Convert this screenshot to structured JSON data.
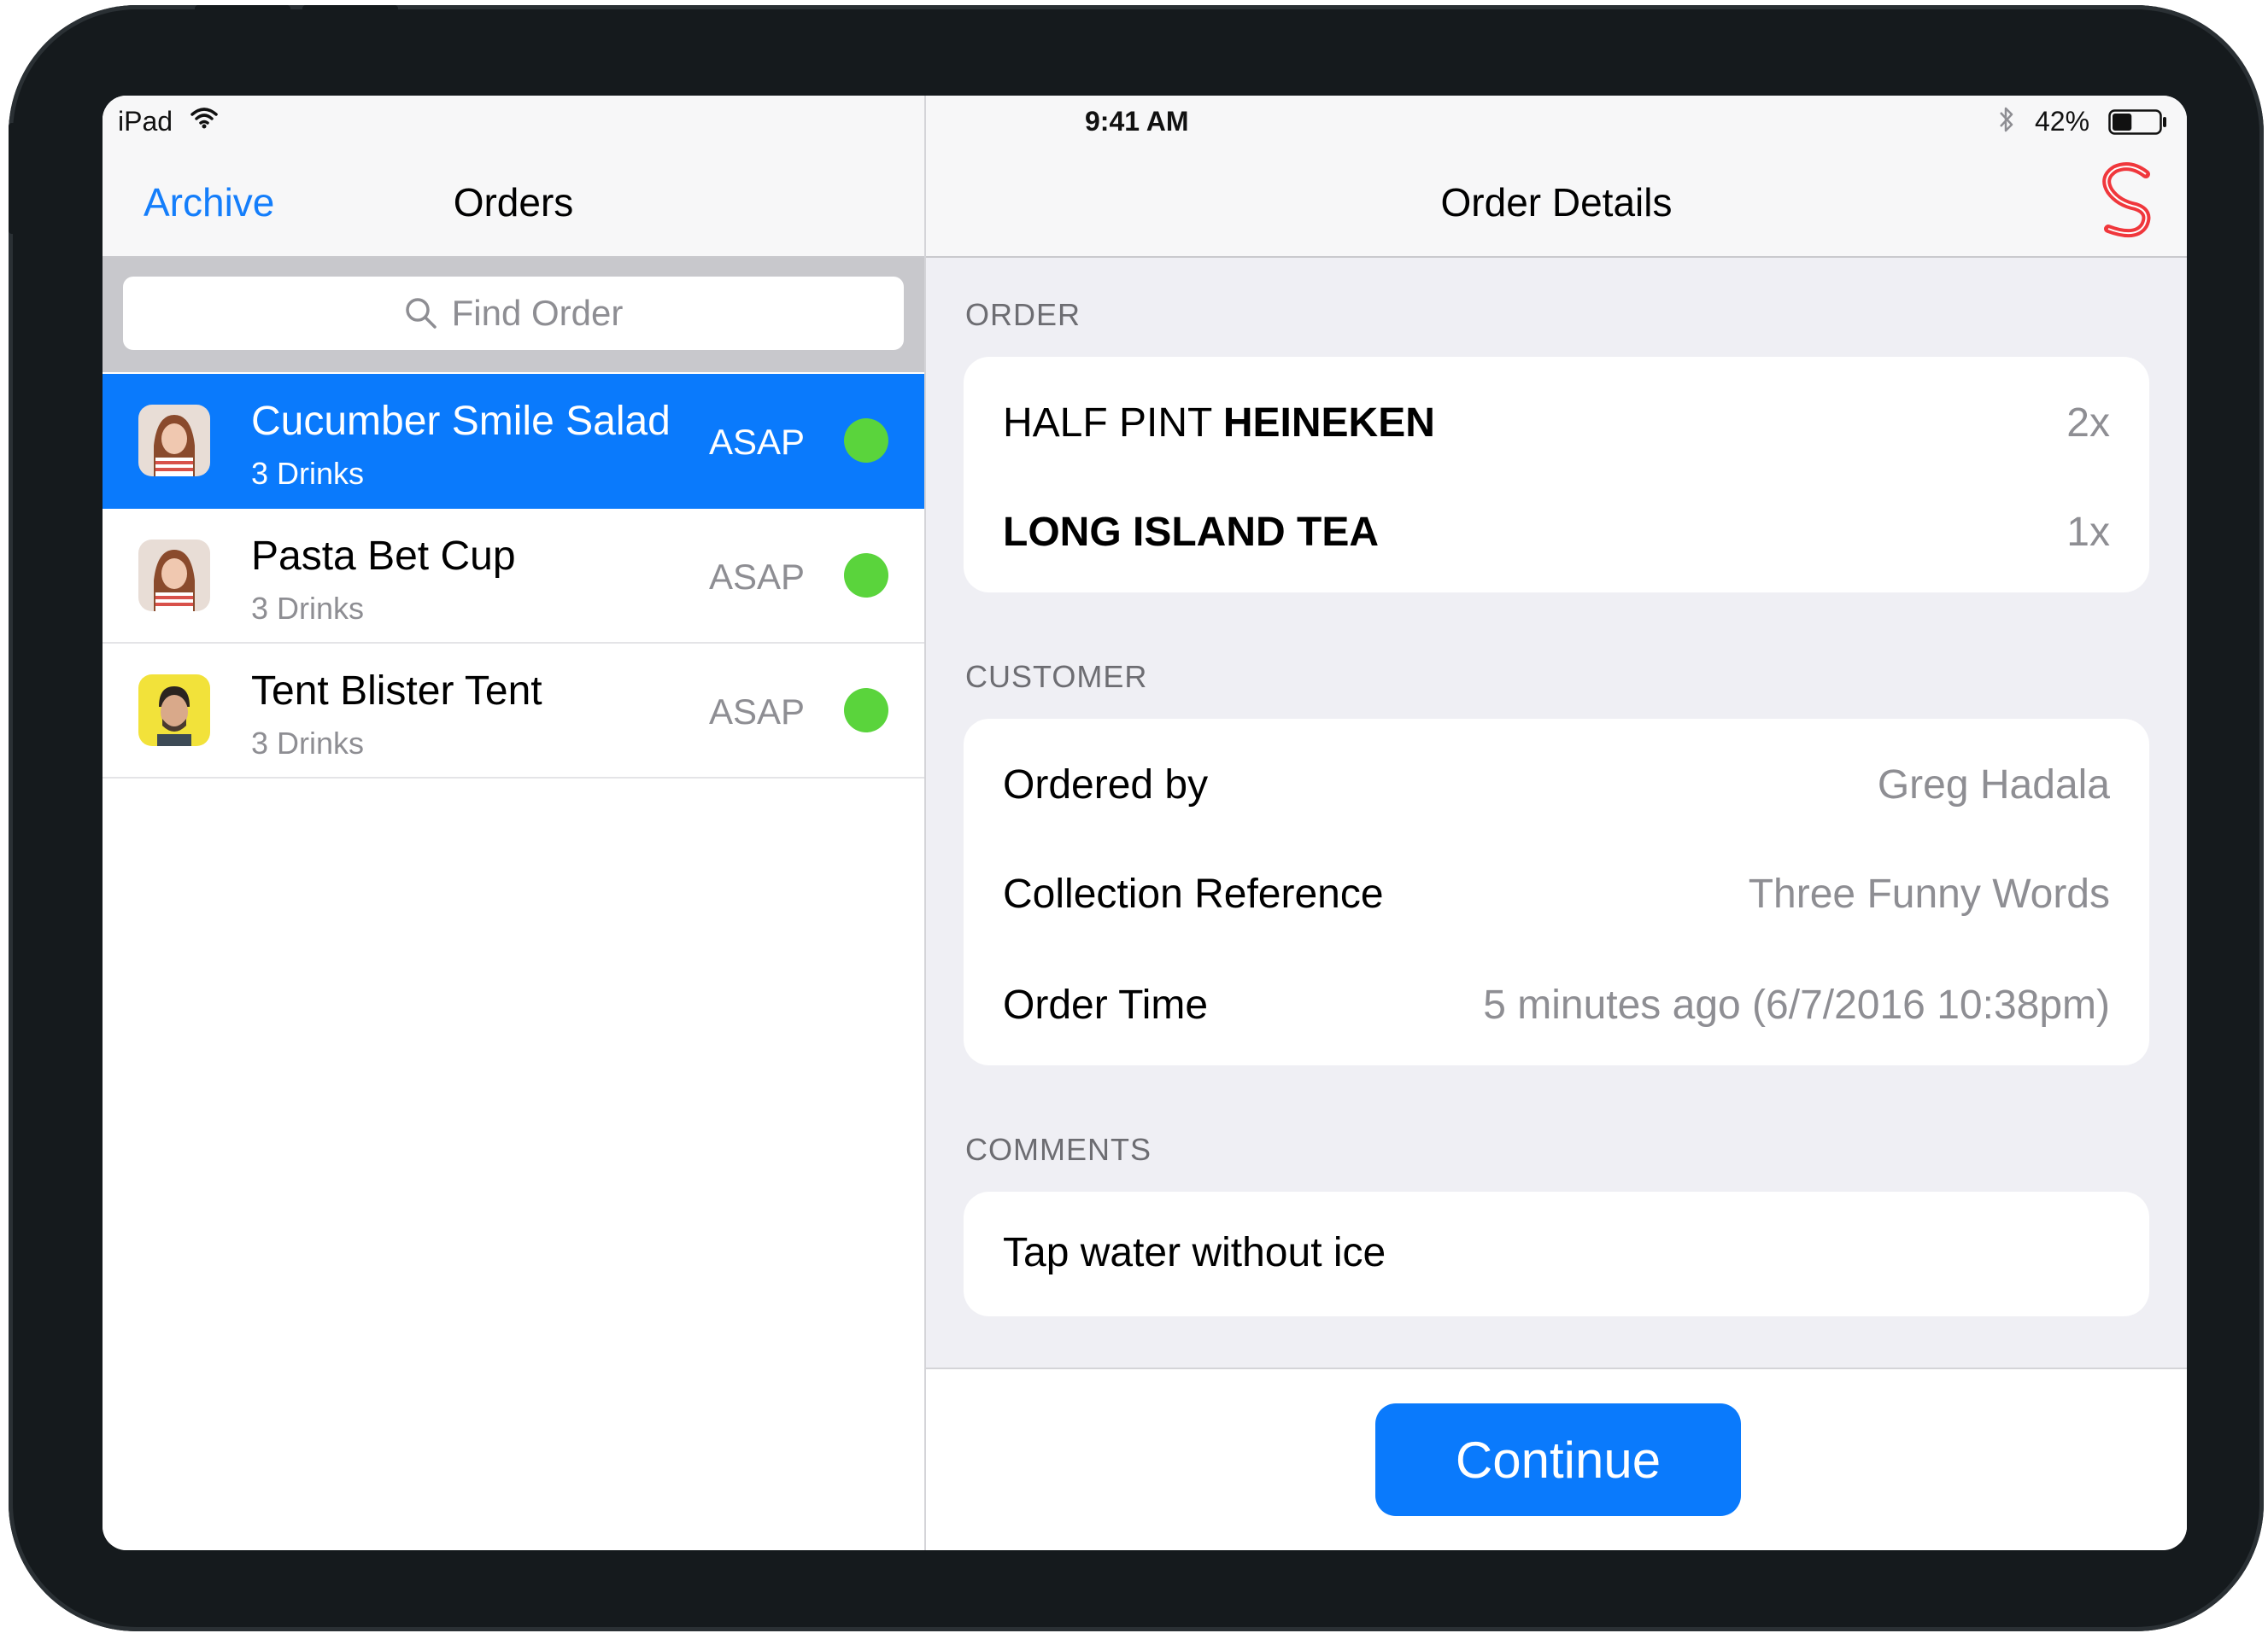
{
  "status_bar": {
    "device": "iPad",
    "time": "9:41 AM",
    "battery_percent": "42%",
    "battery_level": 0.42
  },
  "master": {
    "back_label": "Archive",
    "title": "Orders",
    "search": {
      "placeholder": "Find Order"
    },
    "orders": [
      {
        "name": "Cucumber Smile Salad",
        "subtitle": "3 Drinks",
        "timing": "ASAP",
        "status_color": "#5ad43c",
        "selected": true,
        "avatar": "woman-avatar"
      },
      {
        "name": "Pasta Bet Cup",
        "subtitle": "3 Drinks",
        "timing": "ASAP",
        "status_color": "#5ad43c",
        "selected": false,
        "avatar": "woman-avatar"
      },
      {
        "name": "Tent Blister Tent",
        "subtitle": "3 Drinks",
        "timing": "ASAP",
        "status_color": "#5ad43c",
        "selected": false,
        "avatar": "man-avatar"
      }
    ]
  },
  "detail": {
    "title": "Order Details",
    "sections": {
      "order_label": "ORDER",
      "customer_label": "CUSTOMER",
      "comments_label": "COMMENTS"
    },
    "items": [
      {
        "prefix": "HALF PINT ",
        "name": "HEINEKEN",
        "qty": "2x"
      },
      {
        "prefix": "",
        "name": "LONG ISLAND TEA",
        "qty": "1x"
      }
    ],
    "customer": [
      {
        "label": "Ordered by",
        "value": "Greg Hadala"
      },
      {
        "label": "Collection Reference",
        "value": "Three Funny Words"
      },
      {
        "label": "Order Time",
        "value": "5 minutes ago (6/7/2016 10:38pm)"
      }
    ],
    "comment": "Tap water without ice",
    "continue_label": "Continue"
  },
  "colors": {
    "accent": "#0a7afc",
    "status_ok": "#5ad43c",
    "brand": "#f0373c"
  }
}
